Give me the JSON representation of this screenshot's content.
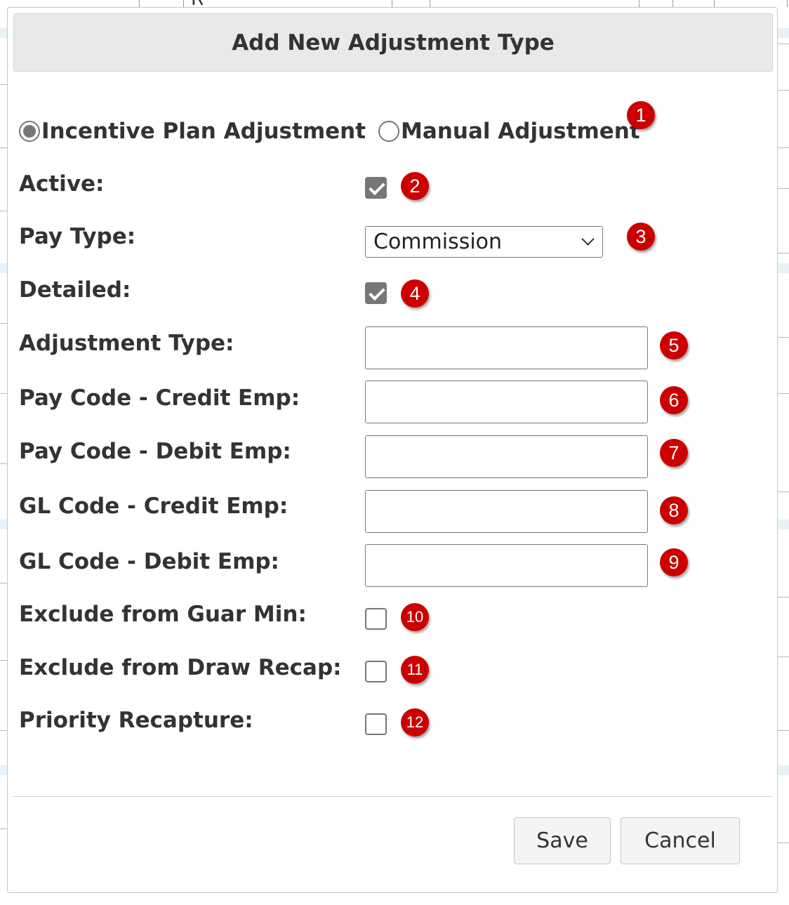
{
  "dialog": {
    "title": "Add New Adjustment Type"
  },
  "adjustment_kind": {
    "options": [
      {
        "label": "Incentive Plan Adjustment",
        "selected": true
      },
      {
        "label": "Manual Adjustment",
        "selected": false
      }
    ]
  },
  "fields": {
    "active": {
      "label": "Active:",
      "checked": true
    },
    "pay_type": {
      "label": "Pay Type:",
      "value": "Commission"
    },
    "detailed": {
      "label": "Detailed:",
      "checked": true
    },
    "adjustment_type": {
      "label": "Adjustment Type:",
      "value": ""
    },
    "pay_code_credit": {
      "label": "Pay Code - Credit Emp:",
      "value": ""
    },
    "pay_code_debit": {
      "label": "Pay Code - Debit Emp:",
      "value": ""
    },
    "gl_code_credit": {
      "label": "GL Code - Credit Emp:",
      "value": ""
    },
    "gl_code_debit": {
      "label": "GL Code - Debit Emp:",
      "value": ""
    },
    "exclude_guar_min": {
      "label": "Exclude from Guar Min:",
      "checked": false
    },
    "exclude_draw_recap": {
      "label": "Exclude from Draw Recap:",
      "checked": false
    },
    "priority_recapture": {
      "label": "Priority Recapture:",
      "checked": false
    }
  },
  "badges": [
    "1",
    "2",
    "3",
    "4",
    "5",
    "6",
    "7",
    "8",
    "9",
    "10",
    "11",
    "12"
  ],
  "buttons": {
    "save": "Save",
    "cancel": "Cancel"
  },
  "background": {
    "glyph": "R"
  },
  "colors": {
    "badge": "#cc0000",
    "titlebar": "#e9e9e9",
    "control_fill": "#767676"
  }
}
